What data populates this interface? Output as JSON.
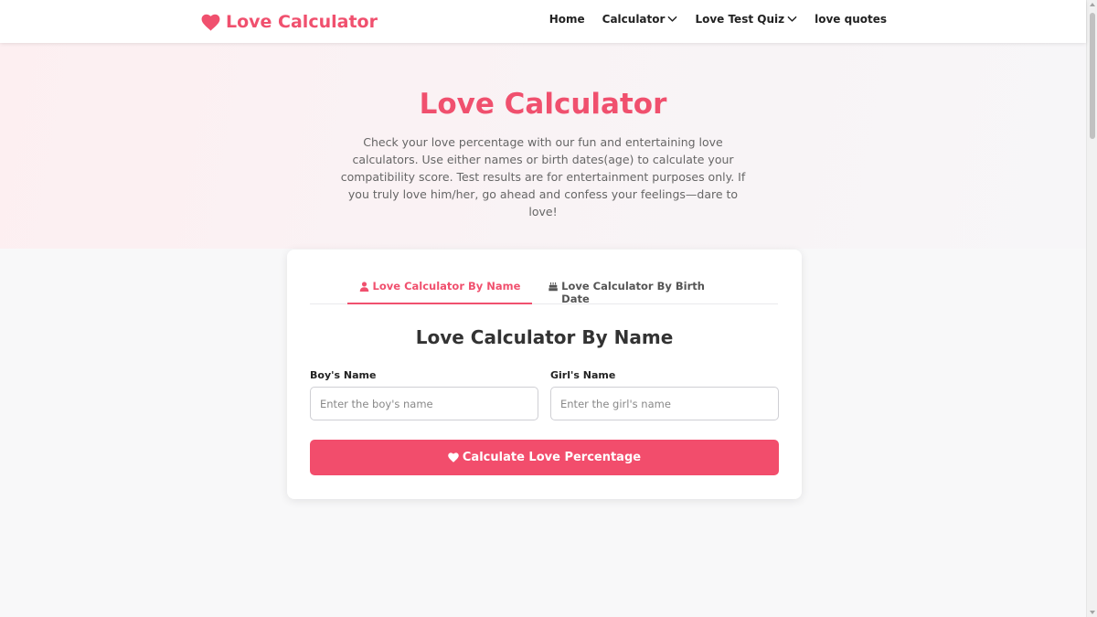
{
  "header": {
    "brand": "Love Calculator",
    "nav": [
      {
        "label": "Home",
        "dropdown": false
      },
      {
        "label": "Calculator",
        "dropdown": true
      },
      {
        "label": "Love Test Quiz",
        "dropdown": true
      },
      {
        "label": "love quotes",
        "dropdown": false
      }
    ]
  },
  "hero": {
    "title": "Love Calculator",
    "description": "Check your love percentage with our fun and entertaining love calculators. Use either names or birth dates(age) to calculate your compatibility score. Test results are for entertainment purposes only. If you truly love him/her, go ahead and confess your feelings—dare to love!"
  },
  "calculator": {
    "tabs": [
      {
        "label": "Love Calculator By Name",
        "icon": "user-icon",
        "active": true
      },
      {
        "label": "Love Calculator By Birth Date",
        "icon": "birthday-cake-icon",
        "active": false
      }
    ],
    "title": "Love Calculator By Name",
    "boy": {
      "label": "Boy's Name",
      "placeholder": "Enter the boy's name",
      "value": ""
    },
    "girl": {
      "label": "Girl's Name",
      "placeholder": "Enter the girl's name",
      "value": ""
    },
    "submit_label": "Calculate Love Percentage"
  },
  "colors": {
    "accent": "#f0506e",
    "button": "#f24d6c",
    "text": "#333333",
    "muted": "#666666"
  }
}
